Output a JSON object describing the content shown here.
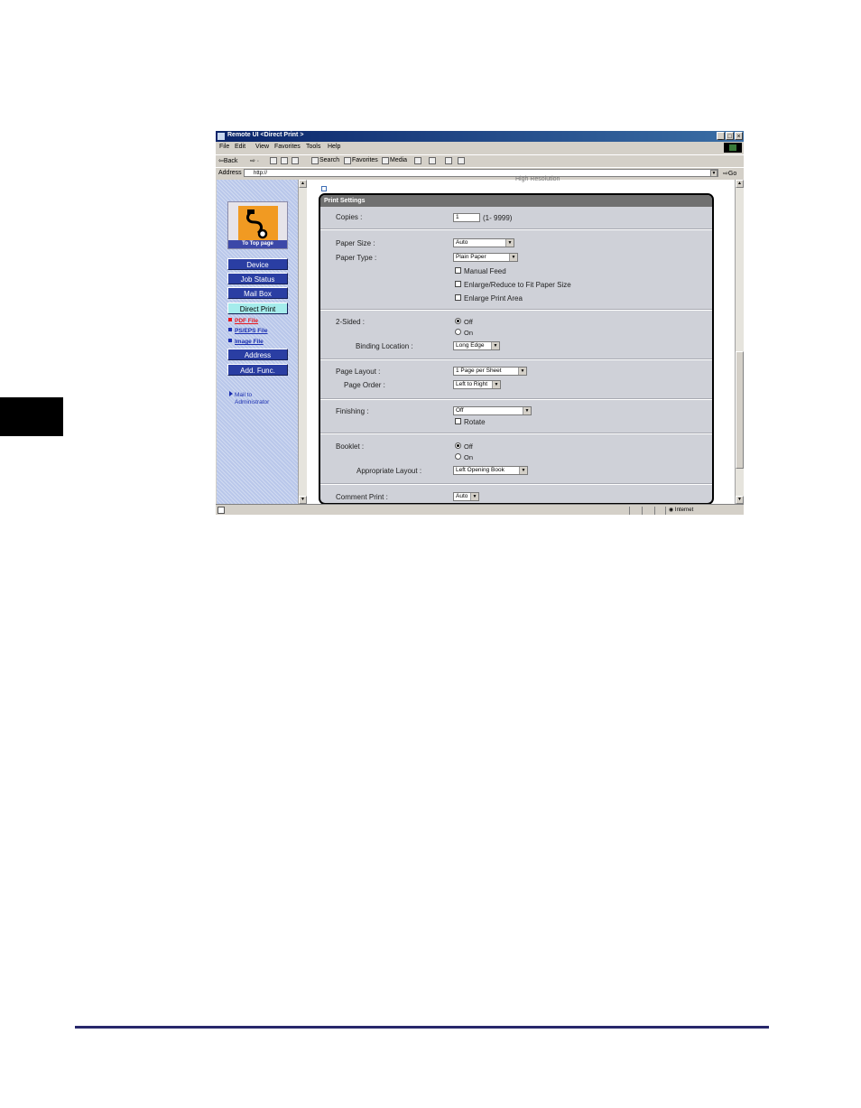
{
  "window": {
    "title": "Remote UI <Direct Print >",
    "controls": [
      "_",
      "□",
      "×"
    ]
  },
  "menu": [
    "File",
    "Edit",
    "View",
    "Favorites",
    "Tools",
    "Help"
  ],
  "toolbar": {
    "back": "⇦Back",
    "search": "Search",
    "favorites": "Favorites",
    "media": "Media"
  },
  "address": {
    "label": "Address",
    "value": "http://",
    "go": "Go"
  },
  "sidebar": {
    "logo_label": "To Top page",
    "nav": {
      "device": "Device",
      "job_status": "Job Status",
      "mail_box": "Mail Box",
      "direct_print": "Direct Print",
      "address": "Address",
      "add_func": "Add. Func."
    },
    "sub": {
      "pdf": "PDF File",
      "ps": "PS/EPS File",
      "image": "Image File"
    },
    "mail": {
      "line1": "Mail to",
      "line2": "Administrator"
    }
  },
  "main": {
    "partial_top": "High Resolution",
    "panel_title": "Print Settings",
    "copies": {
      "label": "Copies :",
      "value": "1",
      "range": "(1- 9999)"
    },
    "paper_size": {
      "label": "Paper Size :",
      "value": "Auto"
    },
    "paper_type": {
      "label": "Paper Type :",
      "value": "Plain Paper"
    },
    "checkboxes": {
      "manual_feed": "Manual Feed",
      "enlarge_fit": "Enlarge/Reduce to Fit Paper Size",
      "enlarge_area": "Enlarge Print Area"
    },
    "two_sided": {
      "label": "2-Sided :",
      "off": "Off",
      "on": "On"
    },
    "binding": {
      "label": "Binding Location :",
      "value": "Long Edge"
    },
    "page_layout": {
      "label": "Page Layout :",
      "value": "1 Page per Sheet"
    },
    "page_order": {
      "label": "Page Order :",
      "value": "Left to Right"
    },
    "finishing": {
      "label": "Finishing :",
      "value": "Off",
      "rotate": "Rotate"
    },
    "booklet": {
      "label": "Booklet :",
      "off": "Off",
      "on": "On"
    },
    "appropriate_layout": {
      "label": "Appropriate Layout :",
      "value": "Left Opening Book"
    },
    "comment_print": {
      "label": "Comment Print :",
      "value": "Auto"
    }
  },
  "status": {
    "zone": "Internet"
  }
}
